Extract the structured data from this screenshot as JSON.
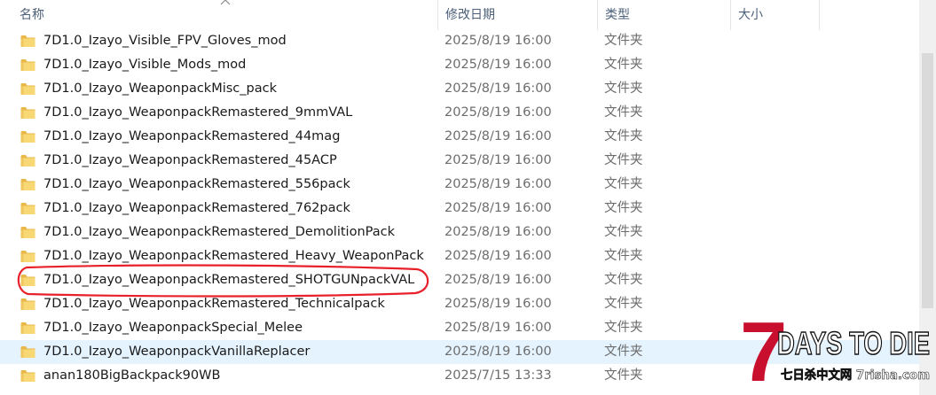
{
  "header": {
    "col_name": "名称",
    "col_date": "修改日期",
    "col_type": "类型",
    "col_size": "大小"
  },
  "rows": [
    {
      "name": "7D1.0_Izayo_Visible_FPV_Gloves_mod",
      "date": "2025/8/19 16:00",
      "type": "文件夹"
    },
    {
      "name": "7D1.0_Izayo_Visible_Mods_mod",
      "date": "2025/8/19 16:00",
      "type": "文件夹"
    },
    {
      "name": "7D1.0_Izayo_WeaponpackMisc_pack",
      "date": "2025/8/19 16:00",
      "type": "文件夹"
    },
    {
      "name": "7D1.0_Izayo_WeaponpackRemastered_9mmVAL",
      "date": "2025/8/19 16:00",
      "type": "文件夹"
    },
    {
      "name": "7D1.0_Izayo_WeaponpackRemastered_44mag",
      "date": "2025/8/19 16:00",
      "type": "文件夹"
    },
    {
      "name": "7D1.0_Izayo_WeaponpackRemastered_45ACP",
      "date": "2025/8/19 16:00",
      "type": "文件夹"
    },
    {
      "name": "7D1.0_Izayo_WeaponpackRemastered_556pack",
      "date": "2025/8/19 16:00",
      "type": "文件夹"
    },
    {
      "name": "7D1.0_Izayo_WeaponpackRemastered_762pack",
      "date": "2025/8/19 16:00",
      "type": "文件夹"
    },
    {
      "name": "7D1.0_Izayo_WeaponpackRemastered_DemolitionPack",
      "date": "2025/8/19 16:00",
      "type": "文件夹"
    },
    {
      "name": "7D1.0_Izayo_WeaponpackRemastered_Heavy_WeaponPack",
      "date": "2025/8/19 16:00",
      "type": "文件夹"
    },
    {
      "name": "7D1.0_Izayo_WeaponpackRemastered_SHOTGUNpackVAL",
      "date": "2025/8/19 16:00",
      "type": "文件夹"
    },
    {
      "name": "7D1.0_Izayo_WeaponpackRemastered_Technicalpack",
      "date": "2025/8/19 16:00",
      "type": "文件夹"
    },
    {
      "name": "7D1.0_Izayo_WeaponpackSpecial_Melee",
      "date": "2025/8/19 16:00",
      "type": "文件夹"
    },
    {
      "name": "7D1.0_Izayo_WeaponpackVanillaReplacer",
      "date": "2025/8/19 16:00",
      "type": "文件夹"
    },
    {
      "name": "anan180BigBackpack90WB",
      "date": "2025/7/15 13:33",
      "type": "文件夹"
    }
  ],
  "hovered_row_index": 13,
  "highlighted_row_index": 10,
  "logo": {
    "main": "DAYS TO DIE",
    "numeral": "7",
    "subtitle": "七日杀中文网 7risha.com"
  },
  "colors": {
    "folder": "#f8d775",
    "folder_dark": "#e8b94a",
    "hover_bg": "#e5f3ff",
    "highlight": "#e8202a",
    "logo_red": "#c8102e"
  },
  "icons": {
    "folder": "folder-icon",
    "sort": "sort-ascending-icon"
  }
}
